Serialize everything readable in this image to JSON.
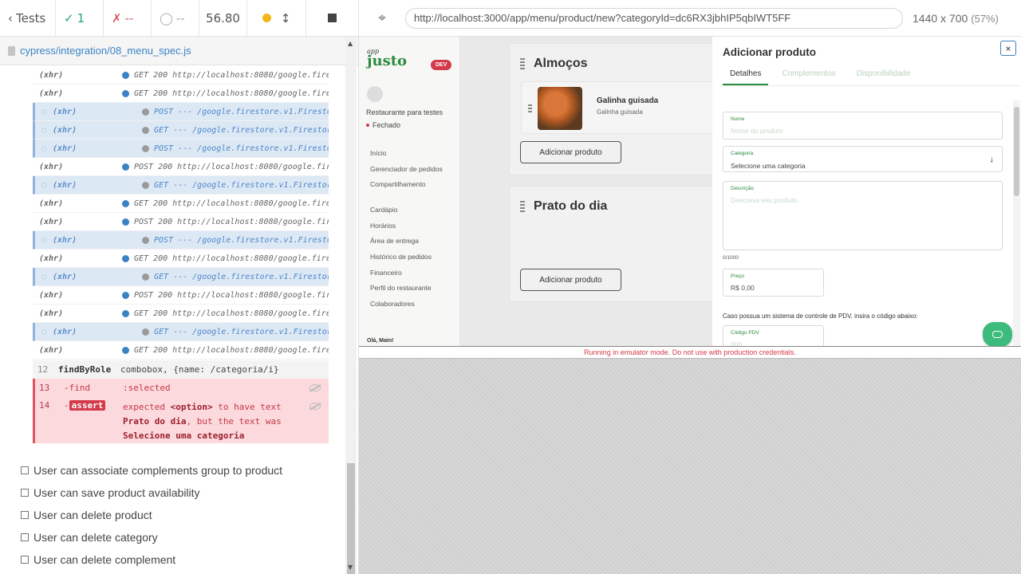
{
  "reporter": {
    "tests_label": "Tests",
    "passed": "1",
    "failed": "--",
    "pending": "--",
    "duration": "56.80",
    "spec_file": "cypress/integration/08_menu_spec.js",
    "commands": [
      {
        "name": "(xhr)",
        "msg": "GET 200 http://localhost:8080/google.fire…",
        "pending": false
      },
      {
        "name": "(xhr)",
        "msg": "GET 200 http://localhost:8080/google.fire…",
        "pending": false
      },
      {
        "name": "(xhr)",
        "msg": "POST --- /google.firestore.v1.Firestore/L…",
        "pending": true
      },
      {
        "name": "(xhr)",
        "msg": "GET --- /google.firestore.v1.Firestore/Li…",
        "pending": true
      },
      {
        "name": "(xhr)",
        "msg": "POST --- /google.firestore.v1.Firestore/L…",
        "pending": true
      },
      {
        "name": "(xhr)",
        "msg": "POST 200 http://localhost:8080/google.fir…",
        "pending": false
      },
      {
        "name": "(xhr)",
        "msg": "GET --- /google.firestore.v1.Firestore/Li…",
        "pending": true
      },
      {
        "name": "(xhr)",
        "msg": "GET 200 http://localhost:8080/google.fire…",
        "pending": false
      },
      {
        "name": "(xhr)",
        "msg": "POST 200 http://localhost:8080/google.fir…",
        "pending": false
      },
      {
        "name": "(xhr)",
        "msg": "POST --- /google.firestore.v1.Firestore/L…",
        "pending": true
      },
      {
        "name": "(xhr)",
        "msg": "GET 200 http://localhost:8080/google.fire…",
        "pending": false
      },
      {
        "name": "(xhr)",
        "msg": "GET --- /google.firestore.v1.Firestore/Li…",
        "pending": true
      },
      {
        "name": "(xhr)",
        "msg": "POST 200 http://localhost:8080/google.fir…",
        "pending": false
      },
      {
        "name": "(xhr)",
        "msg": "GET 200 http://localhost:8080/google.fire…",
        "pending": false
      },
      {
        "name": "(xhr)",
        "msg": "GET --- /google.firestore.v1.Firestore/Li…",
        "pending": true
      },
      {
        "name": "(xhr)",
        "msg": "GET 200 http://localhost:8080/google.fire…",
        "pending": false
      }
    ],
    "row12": {
      "num": "12",
      "name": "findByRole",
      "msg": "combobox, {name: /categoria/i}"
    },
    "row13": {
      "num": "13",
      "name": "-find",
      "msg": ":selected"
    },
    "row14": {
      "num": "14",
      "dash": "-",
      "name": "assert",
      "line1_a": "expected ",
      "line1_b": "<option>",
      "line1_c": " to have text",
      "line2_a": "Prato do dia",
      "line2_b": ", but the text was",
      "line3": "Selecione uma categoria"
    },
    "pending_tests": [
      "User can associate complements group to product",
      "User can save product availability",
      "User can delete product",
      "User can delete category",
      "User can delete complement"
    ]
  },
  "aut": {
    "url": "http://localhost:3000/app/menu/product/new?categoryId=dc6RX3jbhIP5qbIWT5FF",
    "viewport": "1440 x 700",
    "zoom": "(57%)",
    "emulator_warning": "Running in emulator mode. Do not use with production credentials."
  },
  "app": {
    "logo_small": "app",
    "logo": "justo",
    "dev_badge": "DEV",
    "restaurant": "Restaurante para testes",
    "status": "Fechado",
    "nav_group1": [
      "Início",
      "Gerenciador de pedidos",
      "Compartilhamento"
    ],
    "nav_group2": [
      "Cardápio",
      "Horários",
      "Área de entrega",
      "Histórico de pedidos",
      "Financeiro",
      "Perfil do restaurante",
      "Colaboradores"
    ],
    "user_greeting": "Olá, Main!",
    "categories": [
      {
        "title": "Almoços",
        "add_label": "Adicionar produto",
        "product": {
          "name": "Galinha guisada",
          "desc": "Galinha guisada"
        }
      },
      {
        "title": "Prato do dia",
        "add_label": "Adicionar produto"
      }
    ],
    "modal": {
      "title": "Adicionar produto",
      "close": "×",
      "tabs": [
        "Detalhes",
        "Complementos",
        "Disponibilidade"
      ],
      "nome_label": "Nome",
      "nome_placeholder": "Nome do produto",
      "cat_label": "Categoria",
      "cat_value": "Selecione uma categoria",
      "desc_label": "Descrição",
      "desc_placeholder": "Descreva seu produto",
      "char_count": "0/1000",
      "preco_label": "Preço",
      "preco_value": "R$ 0,00",
      "pdv_note": "Caso possua um sistema de controle de PDV, insira o código abaixo:",
      "pdv_label": "Código PDV",
      "pdv_placeholder": "000"
    }
  }
}
